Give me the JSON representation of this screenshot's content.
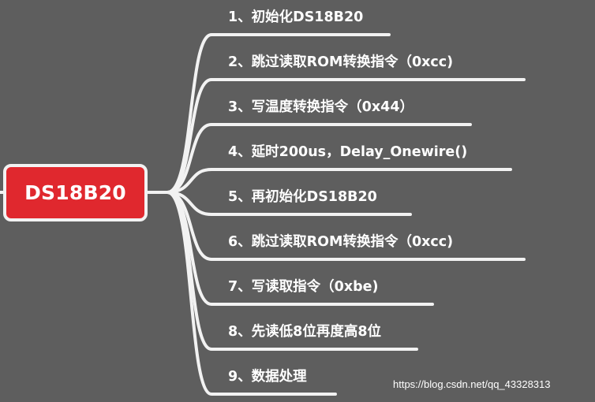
{
  "root": {
    "label": "DS18B20"
  },
  "branches": [
    {
      "label": "1、初始化DS18B20"
    },
    {
      "label": "2、跳过读取ROM转换指令（0xcc)"
    },
    {
      "label": "3、写温度转换指令（0x44）"
    },
    {
      "label": "4、延时200us，Delay_Onewire()"
    },
    {
      "label": "5、再初始化DS18B20"
    },
    {
      "label": "6、跳过读取ROM转换指令（0xcc)"
    },
    {
      "label": "7、写读取指令（0xbe)"
    },
    {
      "label": "8、先读低8位再度高8位"
    },
    {
      "label": "9、数据处理"
    }
  ],
  "watermark": "https://blog.csdn.net/qq_43328313",
  "colors": {
    "background": "#5e5e5e",
    "root_fill": "#e0282e",
    "line": "#f2f2f2",
    "text": "#ffffff"
  }
}
